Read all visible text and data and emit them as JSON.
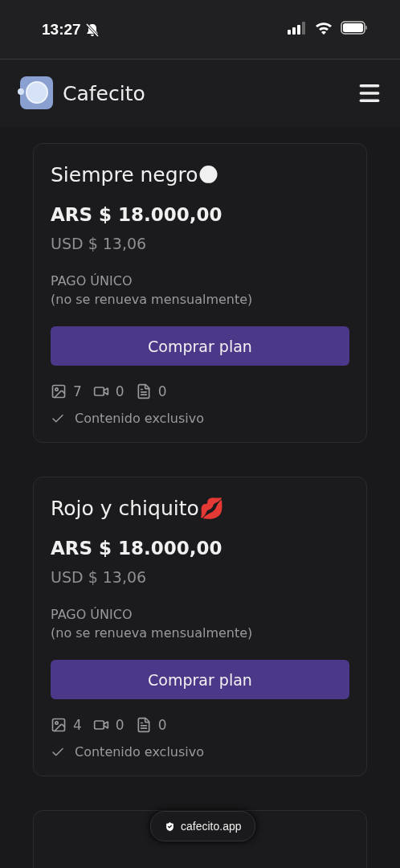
{
  "status_bar": {
    "time": "13:27"
  },
  "header": {
    "brand": "Cafecito"
  },
  "plans": [
    {
      "title": "Siempre negro🌑",
      "price_ars": "ARS $ 18.000,00",
      "price_usd": "USD $ 13,06",
      "payment_type": "PAGO ÚNICO",
      "payment_note": "(no se renueva mensualmente)",
      "button": "Comprar plan",
      "counts": {
        "images": "7",
        "videos": "0",
        "documents": "0"
      },
      "features": [
        "Contenido exclusivo"
      ]
    },
    {
      "title": "Rojo y chiquito💋",
      "price_ars": "ARS $ 18.000,00",
      "price_usd": "USD $ 13,06",
      "payment_type": "PAGO ÚNICO",
      "payment_note": "(no se renueva mensualmente)",
      "button": "Comprar plan",
      "counts": {
        "images": "4",
        "videos": "0",
        "documents": "0"
      },
      "features": [
        "Contenido exclusivo"
      ]
    }
  ],
  "url_pill": {
    "domain": "cafecito.app"
  }
}
